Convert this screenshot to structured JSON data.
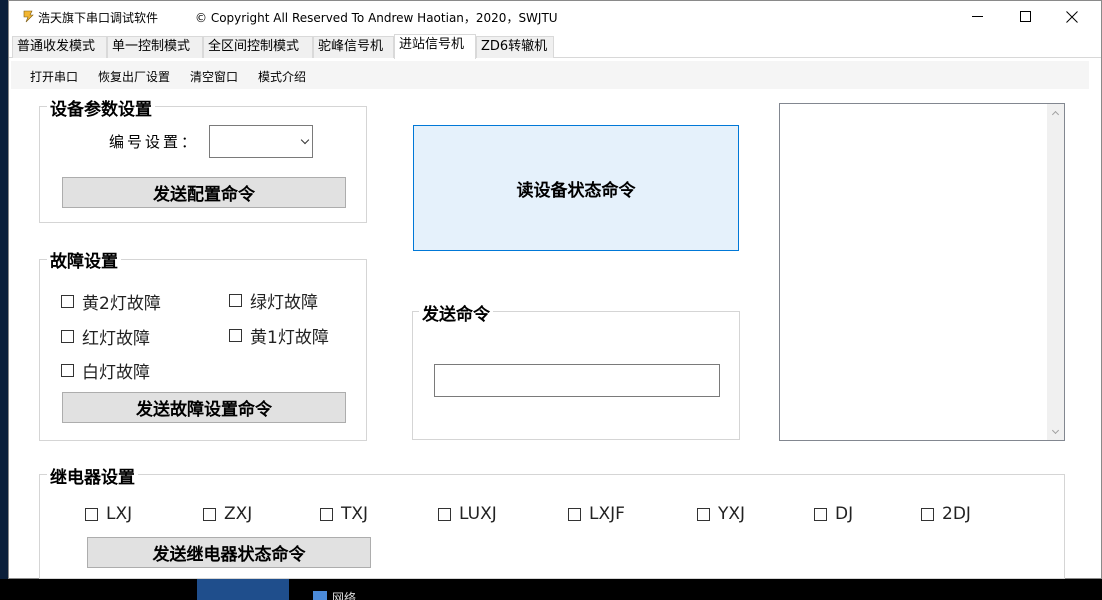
{
  "window": {
    "title": "浩天旗下串口调试软件",
    "copyright": "© Copyright All Reserved To Andrew Haotian，2020，SWJTU"
  },
  "tabs": [
    "普通收发模式",
    "单一控制模式",
    "全区间控制模式",
    "驼峰信号机",
    "进站信号机",
    "ZD6转辙机"
  ],
  "active_tab": "进站信号机",
  "menu": [
    "打开串口",
    "恢复出厂设置",
    "清空窗口",
    "模式介绍"
  ],
  "device_params": {
    "title": "设备参数设置",
    "serial_label": "编号设置：",
    "serial_value": "",
    "send_button": "发送配置命令"
  },
  "fault": {
    "title": "故障设置",
    "options": [
      "黄2灯故障",
      "绿灯故障",
      "红灯故障",
      "黄1灯故障",
      "白灯故障"
    ],
    "send_button": "发送故障设置命令"
  },
  "read_status_button": "读设备状态命令",
  "send_command": {
    "title": "发送命令",
    "value": ""
  },
  "relay": {
    "title": "继电器设置",
    "options": [
      "LXJ",
      "ZXJ",
      "TXJ",
      "LUXJ",
      "LXJF",
      "YXJ",
      "DJ",
      "2DJ"
    ],
    "send_button": "发送继电器状态命令"
  },
  "desktop": {
    "network_label": "网络"
  },
  "colors": {
    "read_button_bg": "#e5f1fb",
    "read_button_border": "#0078d7",
    "button_bg": "#e1e1e1"
  }
}
